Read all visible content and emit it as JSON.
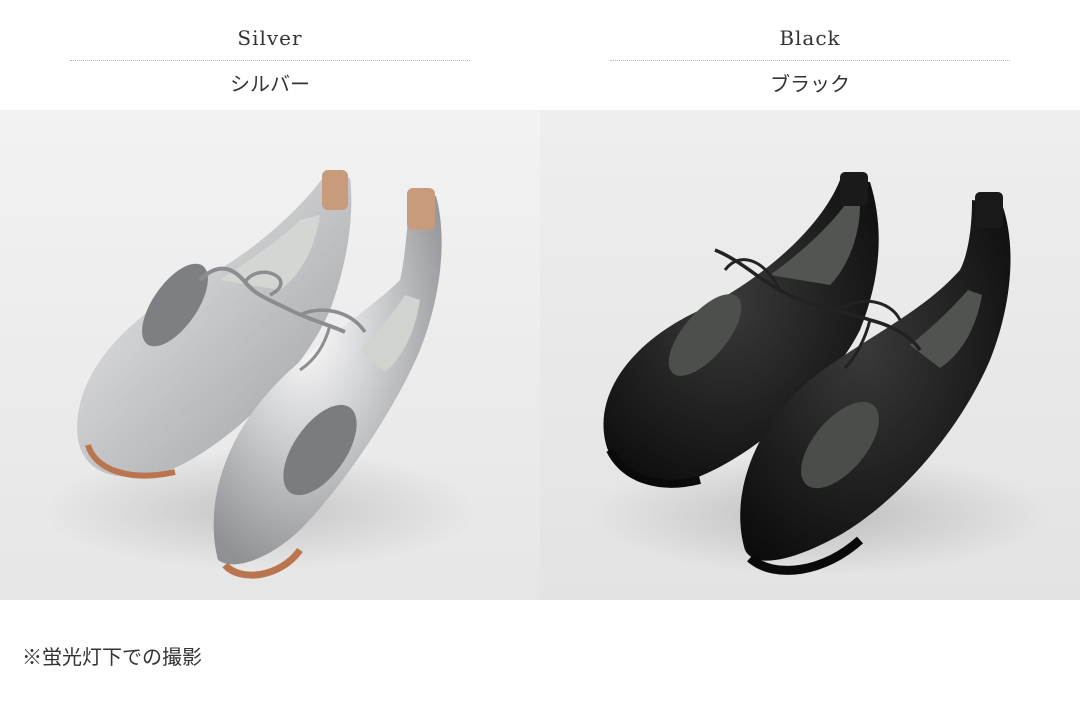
{
  "variants": [
    {
      "name_en": "Silver",
      "name_jp": "シルバー",
      "image_subject": "silver-leather-lace-flat-shoes",
      "shoe_color": "#c9cacc",
      "sole_color": "#b87a52"
    },
    {
      "name_en": "Black",
      "name_jp": "ブラック",
      "image_subject": "black-leather-lace-flat-shoes",
      "shoe_color": "#1c1c1c",
      "sole_color": "#111111"
    }
  ],
  "caption": "※蛍光灯下での撮影",
  "colors": {
    "background": "#ffffff",
    "photo_background": "#eeeeee",
    "text": "#333333"
  }
}
